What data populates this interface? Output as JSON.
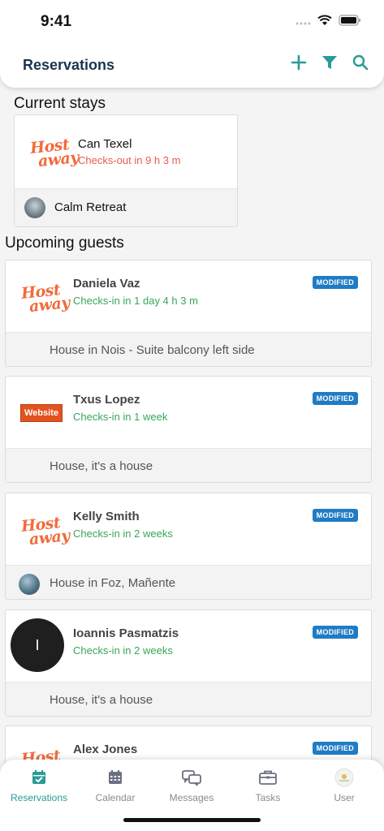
{
  "status_bar": {
    "time": "9:41"
  },
  "header": {
    "title": "Reservations"
  },
  "colors": {
    "accent": "#2a9b96",
    "checkin": "#3aa55b",
    "checkout": "#e85c4a",
    "badge": "#1f7cc4",
    "brand_orange": "#f26b3a"
  },
  "current_stays": {
    "title": "Current stays",
    "items": [
      {
        "logo_line1": "Host",
        "logo_line2": "away",
        "name": "Can Texel",
        "status": "Checks-out in 9 h 3 m",
        "property": "Calm Retreat"
      }
    ]
  },
  "upcoming": {
    "title": "Upcoming guests",
    "items": [
      {
        "logo": "hostaway",
        "logo_line1": "Host",
        "logo_line2": "away",
        "name": "Daniela Vaz",
        "status": "Checks-in in 1 day 4 h 3 m",
        "badge": "MODIFIED",
        "property": "House in Nois - Suite balcony left side"
      },
      {
        "logo": "website",
        "logo_text": "Website",
        "name": "Txus Lopez",
        "status": "Checks-in in 1 week",
        "badge": "MODIFIED",
        "property": "House, it's a house"
      },
      {
        "logo": "hostaway",
        "logo_line1": "Host",
        "logo_line2": "away",
        "name": "Kelly Smith",
        "status": "Checks-in in 2 weeks",
        "badge": "MODIFIED",
        "property": "House in Foz, Mañente"
      },
      {
        "logo": "avatar",
        "initial": "I",
        "name": "Ioannis Pasmatzis",
        "status": "Checks-in in 2 weeks",
        "badge": "MODIFIED",
        "property": "House, it's a house"
      },
      {
        "logo": "hostaway",
        "logo_line1": "Host",
        "logo_line2": "away",
        "name": "Alex Jones",
        "badge": "MODIFIED"
      }
    ]
  },
  "tabs": [
    {
      "label": "Reservations",
      "icon": "calendar-check-icon",
      "active": true
    },
    {
      "label": "Calendar",
      "icon": "calendar-grid-icon"
    },
    {
      "label": "Messages",
      "icon": "chat-bubbles-icon"
    },
    {
      "label": "Tasks",
      "icon": "briefcase-icon"
    },
    {
      "label": "User",
      "icon": "user-avatar-icon"
    }
  ]
}
